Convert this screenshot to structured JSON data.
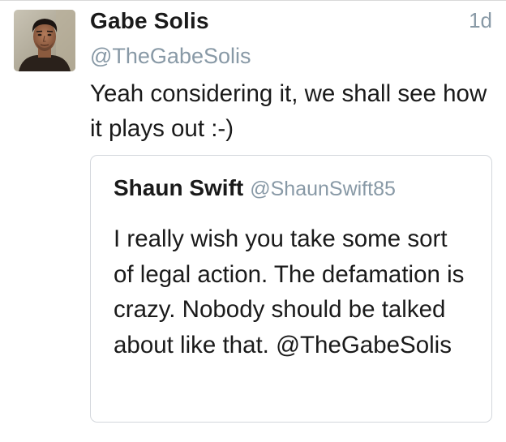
{
  "tweet": {
    "author_name": "Gabe Solis",
    "author_handle": "@TheGabeSolis",
    "timestamp": "1d",
    "text": "Yeah considering it, we shall see how it plays out :-)"
  },
  "quoted_tweet": {
    "author_name": "Shaun Swift",
    "author_handle": "@ShaunSwift85",
    "text": "I really wish you take some sort of legal action. The defamation is crazy. Nobody should be talked about like that. @TheGabeSolis"
  },
  "colors": {
    "text_primary": "#1a1a1a",
    "text_secondary": "#8899a6",
    "card_border": "#d3d7dc",
    "background": "#ffffff"
  },
  "icons": {
    "avatar": "user-profile-photo"
  }
}
